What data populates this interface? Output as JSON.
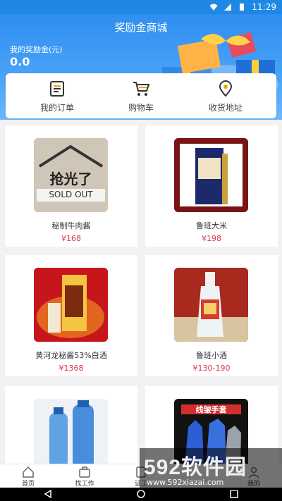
{
  "status_bar": {
    "time": "11:29"
  },
  "header": {
    "title": "奖励金商城",
    "balance_label": "我的奖励金(元)",
    "balance_value": "0.0"
  },
  "menu": {
    "items": [
      {
        "label": "我的订单",
        "icon": "orders-icon"
      },
      {
        "label": "购物车",
        "icon": "cart-icon"
      },
      {
        "label": "收货地址",
        "icon": "location-pin-icon"
      }
    ]
  },
  "products": [
    {
      "name": "秘制牛肉酱",
      "price": "¥168",
      "image_text_1": "抢光了",
      "image_text_2": "SOLD OUT"
    },
    {
      "name": "鲁班大米",
      "price": "¥198"
    },
    {
      "name": "黄河龙秘酱53%白酒",
      "price": "¥1368"
    },
    {
      "name": "鲁班小酒",
      "price": "¥130-190"
    },
    {
      "name": "",
      "price": ""
    },
    {
      "name": "",
      "price": "",
      "image_text_1": "线皱手套"
    }
  ],
  "tabbar": {
    "tabs": [
      {
        "label": "首页"
      },
      {
        "label": "找工作"
      },
      {
        "label": "证工"
      },
      {
        "label": ""
      },
      {
        "label": "我的"
      }
    ]
  },
  "watermark": {
    "big": "592软件园",
    "small": "www.592xiazai.com"
  },
  "colors": {
    "primary": "#1e88e5",
    "price": "#e0334b"
  }
}
